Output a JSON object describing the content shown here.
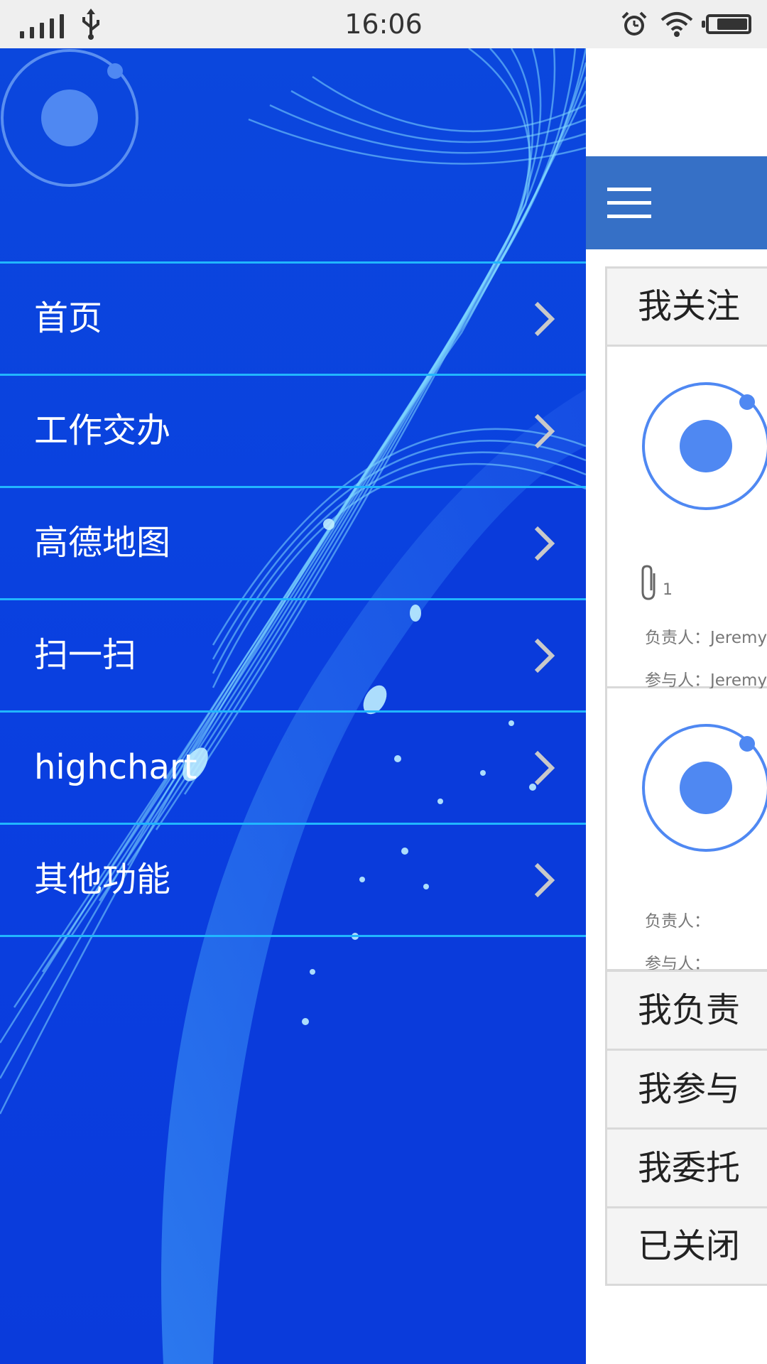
{
  "status_bar": {
    "time": "16:06",
    "icons": [
      "signal-icon",
      "usb-icon",
      "alarm-icon",
      "wifi-icon",
      "battery-charging-icon"
    ]
  },
  "drawer": {
    "logo_icon": "ionic-logo-icon",
    "menu": [
      {
        "label": "首页"
      },
      {
        "label": "工作交办"
      },
      {
        "label": "高德地图"
      },
      {
        "label": "扫一扫"
      },
      {
        "label": "highchart"
      },
      {
        "label": "其他功能"
      }
    ],
    "colors": {
      "background": "#0a3fe0",
      "divider": "#21b6ff",
      "text": "#ffffff"
    }
  },
  "main": {
    "header": {
      "menu_icon": "hamburger-icon",
      "color": "#3670c6"
    },
    "sections": {
      "following": "我关注",
      "responsible": "我负责",
      "participating": "我参与",
      "delegated": "我委托",
      "closed": "已关闭"
    },
    "cards": [
      {
        "attachment_count": "1",
        "owner_label": "负责人：",
        "owner": "Jeremy",
        "participants_label": "参与人：",
        "participants": "Jeremy"
      },
      {
        "owner_label": "负责人：",
        "owner": "",
        "participants_label": "参与人：",
        "participants": ""
      }
    ]
  }
}
